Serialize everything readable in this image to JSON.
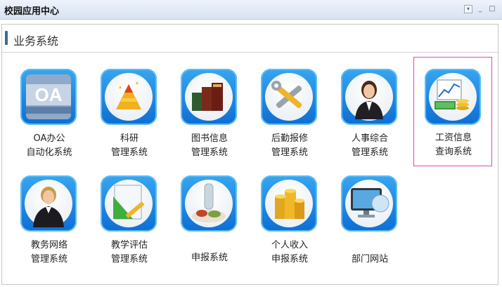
{
  "window": {
    "title": "校园应用中心"
  },
  "section": {
    "title": "业务系统"
  },
  "apps": [
    {
      "line1": "OA办公",
      "line2": "自动化系统",
      "icon": "oa-icon"
    },
    {
      "line1": "科研",
      "line2": "管理系统",
      "icon": "research-pyramid-icon"
    },
    {
      "line1": "图书信息",
      "line2": "管理系统",
      "icon": "books-icon"
    },
    {
      "line1": "后勤报修",
      "line2": "管理系统",
      "icon": "repair-tools-icon"
    },
    {
      "line1": "人事综合",
      "line2": "管理系统",
      "icon": "hr-person-icon"
    },
    {
      "line1": "工资信息",
      "line2": "查询系统",
      "icon": "salary-chart-icon"
    },
    {
      "line1": "教务网络",
      "line2": "管理系统",
      "icon": "teacher-icon"
    },
    {
      "line1": "教学评估",
      "line2": "管理系统",
      "icon": "evaluation-ruler-icon"
    },
    {
      "line1": "申报系统",
      "line2": "",
      "icon": "food-bottle-icon"
    },
    {
      "line1": "个人收入",
      "line2": "申报系统",
      "icon": "coins-stack-icon"
    },
    {
      "line1": "部门网站",
      "line2": "",
      "icon": "computer-monitor-icon"
    }
  ]
}
